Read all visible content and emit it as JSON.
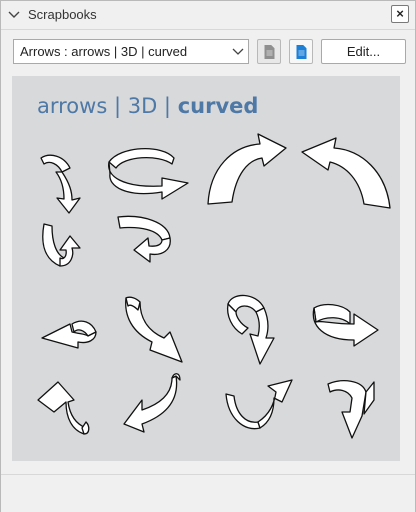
{
  "panel": {
    "title": "Scrapbooks",
    "close_label": "×"
  },
  "toolbar": {
    "selected_scrapbook": "Arrows : arrows | 3D | curved",
    "edit_label": "Edit..."
  },
  "canvas": {
    "heading_part1": "arrows",
    "separator1": " | ",
    "heading_part2": "3D",
    "separator2": " | ",
    "heading_part3": "curved"
  },
  "colors": {
    "heading_blue": "#4e78a5",
    "canvas_bg": "#d8d9db",
    "doc_icon_blue": "#1e7fd6"
  },
  "items": [
    {
      "name": "curved-3d-arrow-down"
    },
    {
      "name": "curved-3d-arrow-circle-right"
    },
    {
      "name": "curved-arrow-big-up-right"
    },
    {
      "name": "curved-arrow-big-up-left"
    },
    {
      "name": "curved-3d-arrow-up-right"
    },
    {
      "name": "curved-3d-arrow-down-left"
    },
    {
      "name": "curved-3d-arrow-left"
    },
    {
      "name": "curved-3d-arrow-down-right"
    },
    {
      "name": "curved-3d-arrow-ribbon-down"
    },
    {
      "name": "curved-3d-arrow-ribbon-right"
    },
    {
      "name": "curved-3d-arrow-up-left-small"
    },
    {
      "name": "curved-3d-arrow-down-left-long"
    },
    {
      "name": "curved-3d-arrow-up-right-bowl"
    },
    {
      "name": "curved-3d-arrow-up-right-hook"
    }
  ]
}
